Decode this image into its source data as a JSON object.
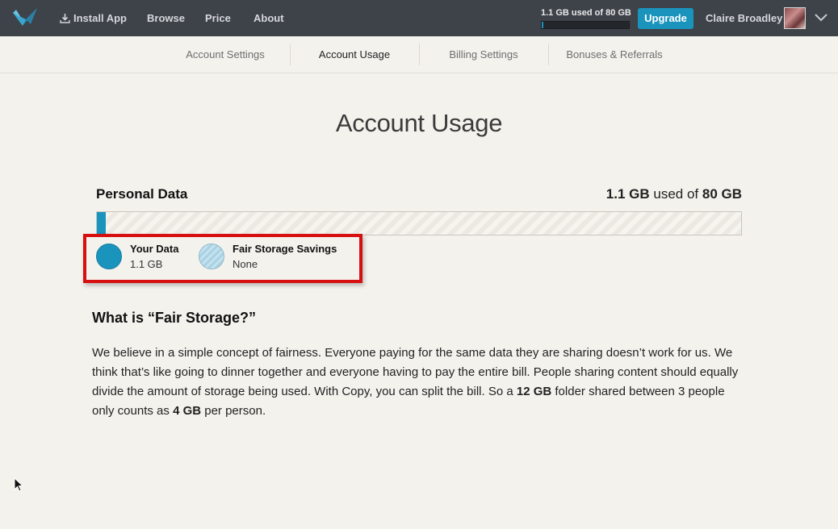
{
  "nav": {
    "install_label": "Install App",
    "browse_label": "Browse",
    "price_label": "Price",
    "about_label": "About",
    "usage_text": "1.1 GB used of 80 GB",
    "usage_fraction": 0.014,
    "upgrade_label": "Upgrade",
    "user_name": "Claire Broadley"
  },
  "tabs": [
    {
      "label": "Account Settings",
      "active": false
    },
    {
      "label": "Account Usage",
      "active": true
    },
    {
      "label": "Billing Settings",
      "active": false
    },
    {
      "label": "Bonuses & Referrals",
      "active": false
    }
  ],
  "page_title": "Account Usage",
  "personal_data": {
    "label": "Personal Data",
    "used_value": "1.1 GB",
    "used_of_text": "used of",
    "total_value": "80 GB",
    "used_fraction": 0.014
  },
  "legend": {
    "your_data_title": "Your Data",
    "your_data_value": "1.1 GB",
    "fair_title": "Fair Storage Savings",
    "fair_value": "None"
  },
  "fair_storage": {
    "heading": "What is “Fair Storage?”",
    "body_part1": "We believe in a simple concept of fairness. Everyone paying for the same data they are sharing doesn’t work for us. We think that’s like going to dinner together and everyone having to pay the entire bill. People sharing content should equally divide the amount of storage being used. With Copy, you can split the bill. So a ",
    "body_bold1": "12 GB",
    "body_part2": " folder shared between 3 people only counts as ",
    "body_bold2": "4 GB",
    "body_part3": " per person."
  },
  "colors": {
    "accent": "#1a94bd",
    "topbar": "#3e4249",
    "highlight": "#d70f0f",
    "background": "#f4f2ed"
  }
}
